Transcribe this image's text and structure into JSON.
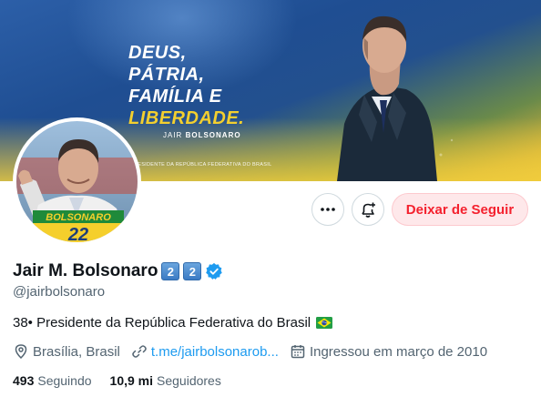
{
  "banner": {
    "slogan": [
      "DEUS,",
      "PÁTRIA,",
      "FAMÍLIA E",
      "LIBERDADE."
    ],
    "signature_first": "JAIR",
    "signature_last": "BOLSONARO",
    "subtitle": "PRESIDENTE DA REPÚBLICA FEDERATIVA DO BRASIL"
  },
  "avatar": {
    "badge_text": "BOLSONARO",
    "badge_number": "22"
  },
  "actions": {
    "unfollow_label": "Deixar de Seguir",
    "more_icon": "more-horizontal-icon",
    "notify_icon": "bell-plus-icon"
  },
  "profile": {
    "display_name": "Jair M. Bolsonaro",
    "keycaps": [
      "2",
      "2"
    ],
    "handle": "@jairbolsonaro",
    "bio": "38• Presidente da República Federativa do Brasil",
    "location": "Brasília, Brasil",
    "link": "t.me/jairbolsonarob...",
    "joined": "Ingressou em março de 2010",
    "following_count": "493",
    "following_label": "Seguindo",
    "followers_count": "10,9 mi",
    "followers_label": "Seguidores"
  },
  "colors": {
    "accent": "#1d9bf0",
    "unfollow_text": "#f4212e",
    "unfollow_bg": "#fee8ea",
    "slogan_accent": "#f3cf2f",
    "muted": "#536471"
  }
}
